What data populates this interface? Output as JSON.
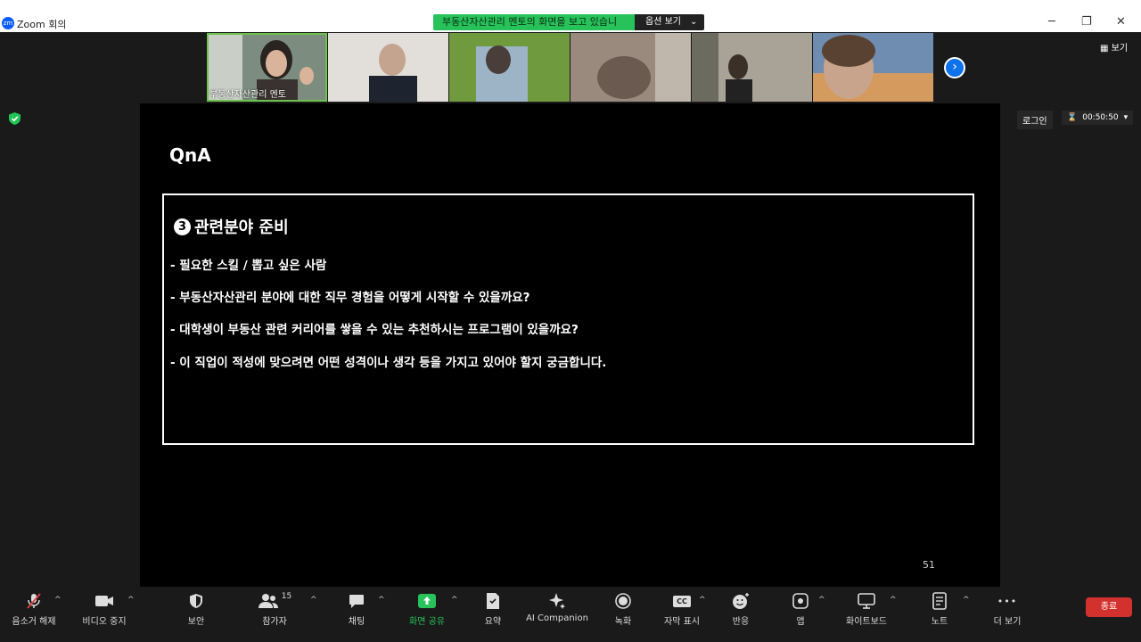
{
  "window": {
    "logo_text": "zm",
    "title": "Zoom 회의"
  },
  "share_banner": {
    "text": "부동산자산관리 멘토의 화면을 보고 있습니다",
    "options_label": "옵션 보기",
    "options_chevron": "⌄"
  },
  "window_controls": {
    "minimize": "─",
    "restore": "❐",
    "close": "✕"
  },
  "thumbnails": [
    {
      "name": "부동산자산관리 멘토",
      "bg": "#6d7f74"
    },
    {
      "name": "",
      "bg": "#d8d4cf"
    },
    {
      "name": "",
      "bg": "#6f9a3e"
    },
    {
      "name": "",
      "bg": "#9a8a7e"
    },
    {
      "name": "",
      "bg": "#8a8578"
    },
    {
      "name": "",
      "bg": "#b69a82"
    }
  ],
  "view_button": {
    "icon": "grid-icon",
    "label": "보기"
  },
  "next_button": {
    "glyph": "›"
  },
  "slide": {
    "title": "QnA",
    "section_number": "3",
    "section_title": "관련분야 준비",
    "questions": [
      "- 필요한 스킬 / 뽑고 싶은 사람",
      "- 부동산자산관리 분야에 대한 직무 경험을 어떻게 시작할 수 있을까요?",
      "- 대학생이 부동산 관련 커리어를 쌓을 수 있는  추천하시는 프로그램이 있을까요?",
      "- 이 직업이 적성에 맞으려면 어떤 성격이나 생각 등을 가지고 있어야 할지 궁금합니다."
    ],
    "page_number": "51"
  },
  "login_button": "로그인",
  "timer": {
    "value": "00:50:50",
    "icon": "hourglass-icon",
    "dropdown": "▾"
  },
  "toolbar": {
    "mute": "음소거 해제",
    "video": "비디오 중지",
    "security": "보안",
    "participants": "참가자",
    "participants_count": "15",
    "chat": "채팅",
    "share": "화면 공유",
    "summary": "요약",
    "ai": "AI Companion",
    "record": "녹화",
    "captions": "자막 표시",
    "captions_icon_text": "CC",
    "reactions": "반응",
    "apps": "앱",
    "whiteboard": "화이트보드",
    "notes": "노트",
    "more": "더 보기",
    "more_glyph": "•••",
    "caret": "^"
  },
  "end_button": "종료",
  "colors": {
    "share_green": "#27c25a",
    "zoom_blue": "#0e72ed",
    "end_red": "#d3312d"
  }
}
